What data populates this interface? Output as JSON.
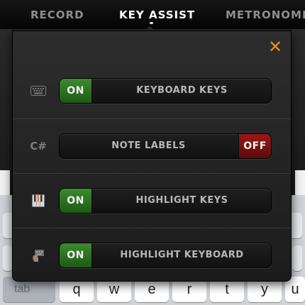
{
  "tabs": [
    {
      "label": "RECORD",
      "active": false
    },
    {
      "label": "KEY ASSIST",
      "active": true
    },
    {
      "label": "METRONOME",
      "active": false
    }
  ],
  "popover": {
    "close_icon": "close-icon",
    "close_glyph": "✕",
    "accent_color": "#f08a1c",
    "rows": [
      {
        "icon": "keyboard-icon",
        "label": "KEYBOARD KEYS",
        "state": "ON"
      },
      {
        "icon": "note-label-icon",
        "icon_text": "C#",
        "label": "NOTE LABELS",
        "state": "OFF"
      },
      {
        "icon": "piano-keys-icon",
        "label": "HIGHLIGHT KEYS",
        "state": "ON"
      },
      {
        "icon": "hand-keyboard-icon",
        "label": "HIGHLIGHT KEYBOARD",
        "state": "ON"
      }
    ]
  },
  "keyboard": {
    "tab_label": "tab",
    "keys": [
      "q",
      "w",
      "e",
      "r",
      "t",
      "y",
      "u"
    ]
  },
  "colors": {
    "on": "#2e7a22",
    "off": "#8a1515"
  }
}
